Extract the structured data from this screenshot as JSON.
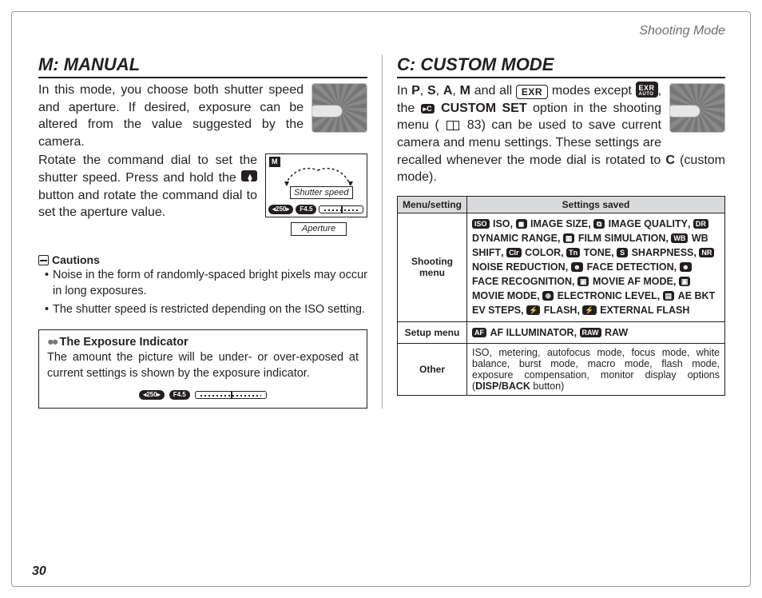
{
  "header": {
    "section": "Shooting Mode"
  },
  "page_number": "30",
  "left": {
    "title": "M: MANUAL",
    "p1": "In this mode, you choose both shutter speed and aperture.  If desired, exposure can be altered from the value suggested by the camera.",
    "p2a": "Rotate the command dial to set the shutter speed.  Press and hold the ",
    "p2b": " button and rotate the command dial to set the aperture value.",
    "lcd": {
      "shutter_label": "Shutter speed",
      "aperture_label": "Aperture",
      "pill_ss": "◂250▸",
      "pill_ap": "F4.5"
    },
    "cautions": {
      "title": "Cautions",
      "items": [
        "Noise in the form of randomly-spaced bright pixels may occur in long exposures.",
        "The shutter speed is restricted depending on the ISO setting."
      ]
    },
    "note": {
      "title": "The Exposure Indicator",
      "body": "The amount the picture will be under- or over-exposed at current settings is shown by the exposure indicator.",
      "pill_ss": "◂250▸",
      "pill_ap": "F4.5"
    }
  },
  "right": {
    "title": "C: CUSTOM MODE",
    "p1a": "In ",
    "modes": "P, S, A, M",
    "p1b": " and all ",
    "p1c": " modes except ",
    "p1d": ", the ",
    "customset": " CUSTOM SET",
    "p1e": " option in the shooting menu (",
    "pageref": " 83",
    "p1f": ") can be used to save current camera and menu settings.  These settings are recalled whenever the mode dial is rotated to ",
    "modeC": "C",
    "p1g": " (custom mode).",
    "table": {
      "h1": "Menu/setting",
      "h2": "Settings saved",
      "r1_head": "Shooting menu",
      "r1_items": " ISO,  IMAGE SIZE,  IMAGE QUALITY,  DYNAMIC RANGE,  FILM SIMULATION,  WB SHIFT,  COLOR,  TONE,  SHARPNESS,  NOISE REDUCTION,  FACE DETECTION,  FACE RECOGNITION,  MOVIE AF MODE,  MOVIE MODE,  ELECTRONIC LEVEL,  AE BKT EV STEPS,  FLASH,  EXTERNAL FLASH",
      "r2_head": "Setup menu",
      "r2_items": " AF ILLUMINATOR,  RAW",
      "r3_head": "Other",
      "r3_body_a": "ISO, metering, autofocus mode, focus mode, white balance, burst mode, macro mode, flash mode, exposure compensation, monitor display options (",
      "r3_body_b": "DISP/BACK",
      "r3_body_c": " button)"
    }
  }
}
